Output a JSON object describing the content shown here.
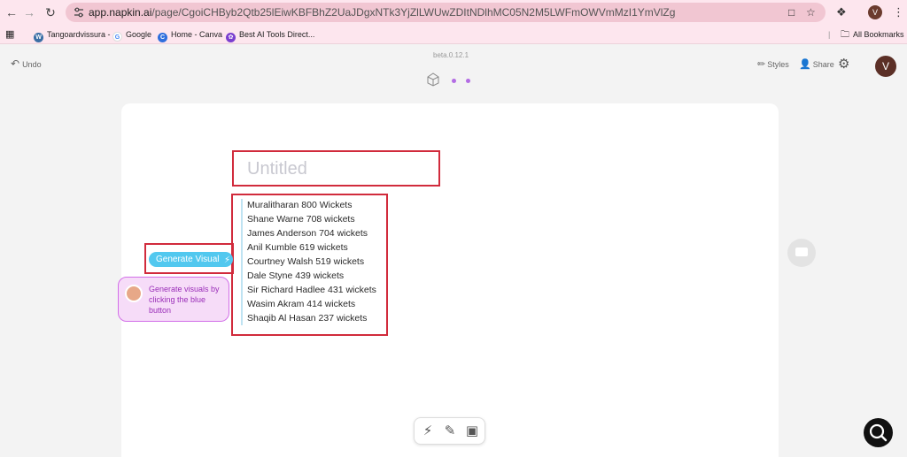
{
  "browser": {
    "url_host": "app.napkin.ai",
    "url_path": "/page/CgoiCHByb2Qtb25lEiwKBFBhZ2UaJDgxNTk3YjZlLWUwZDItNDlhMC05N2M5LWFmOWVmMzI1YmVlZg",
    "profile_initial": "V",
    "bookmarks": [
      {
        "label": "Tangoardvissura -",
        "icon": "wordpress-icon",
        "color": "#3a6ea5"
      },
      {
        "label": "Google",
        "icon": "google-icon",
        "color": "#4285f4"
      },
      {
        "label": "Home - Canva",
        "icon": "canva-icon",
        "color": "#2f6fdd"
      },
      {
        "label": "Best AI Tools Direct...",
        "icon": "ai-tools-icon",
        "color": "#7a3fcf"
      }
    ],
    "all_bookmarks": "All Bookmarks"
  },
  "app": {
    "undo_label": "Undo",
    "version": "beta.0.12.1",
    "styles_label": "Styles",
    "share_label": "Share",
    "user_initial": "V"
  },
  "document": {
    "title_placeholder": "Untitled",
    "items": [
      "Muralitharan 800 Wickets",
      "Shane Warne 708 wickets",
      "James Anderson 704 wickets",
      "Anil Kumble 619 wickets",
      "Courtney Walsh 519 wickets",
      "Dale Styne 439 wickets",
      "Sir Richard Hadlee 431 wickets",
      "Wasim Akram 414 wickets",
      "Shaqib Al Hasan 237 wickets"
    ],
    "generate_label": "Generate Visual",
    "hint_text": "Generate visuals by clicking the blue button"
  },
  "colors": {
    "accent": "#52c8ef",
    "highlight_border": "#d12b3c",
    "hint_purple": "#9a2fb8"
  }
}
